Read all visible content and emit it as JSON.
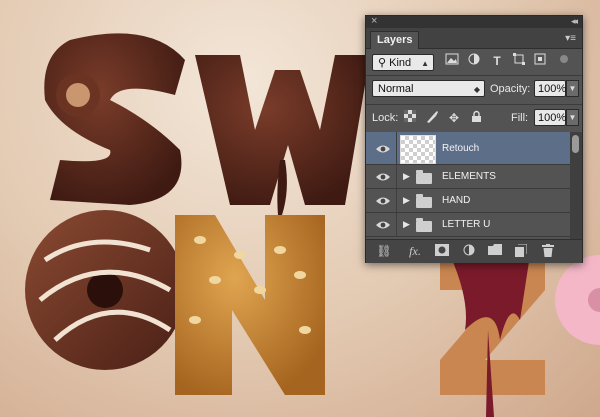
{
  "panel": {
    "title_tab": "Layers",
    "close_glyph": "×",
    "collapse_glyph": "◂◂",
    "menu_glyph": "▾≡",
    "filter": {
      "kind_label": "Kind",
      "search_glyph": "⚲"
    },
    "blend_mode": "Normal",
    "opacity_label": "Opacity:",
    "opacity_value": "100%",
    "lock_label": "Lock:",
    "fill_label": "Fill:",
    "fill_value": "100%",
    "filter_icons": [
      "image-filter-icon",
      "adjustment-filter-icon",
      "type-filter-icon",
      "shape-filter-icon",
      "smart-object-filter-icon",
      "filter-toggle-icon"
    ],
    "lock_icons": [
      "lock-transparent-icon",
      "lock-image-icon",
      "lock-position-icon",
      "lock-all-icon"
    ],
    "layers": [
      {
        "name": "Retouch",
        "type": "pixel",
        "selected": true,
        "visible": true
      },
      {
        "name": "ELEMENTS",
        "type": "group",
        "selected": false,
        "visible": true
      },
      {
        "name": "HAND",
        "type": "group",
        "selected": false,
        "visible": true
      },
      {
        "name": "LETTER U",
        "type": "group",
        "selected": false,
        "visible": true
      }
    ],
    "footer_icons": [
      "link-layers-icon",
      "fx-icon",
      "add-mask-icon",
      "adjustment-layer-icon",
      "new-group-icon",
      "new-layer-icon",
      "delete-layer-icon"
    ]
  },
  "colors": {
    "panel_bg": "#535353",
    "selected_row": "#5d6f88",
    "chocolate": "#5a2a1e",
    "biscuit": "#c9862e"
  }
}
